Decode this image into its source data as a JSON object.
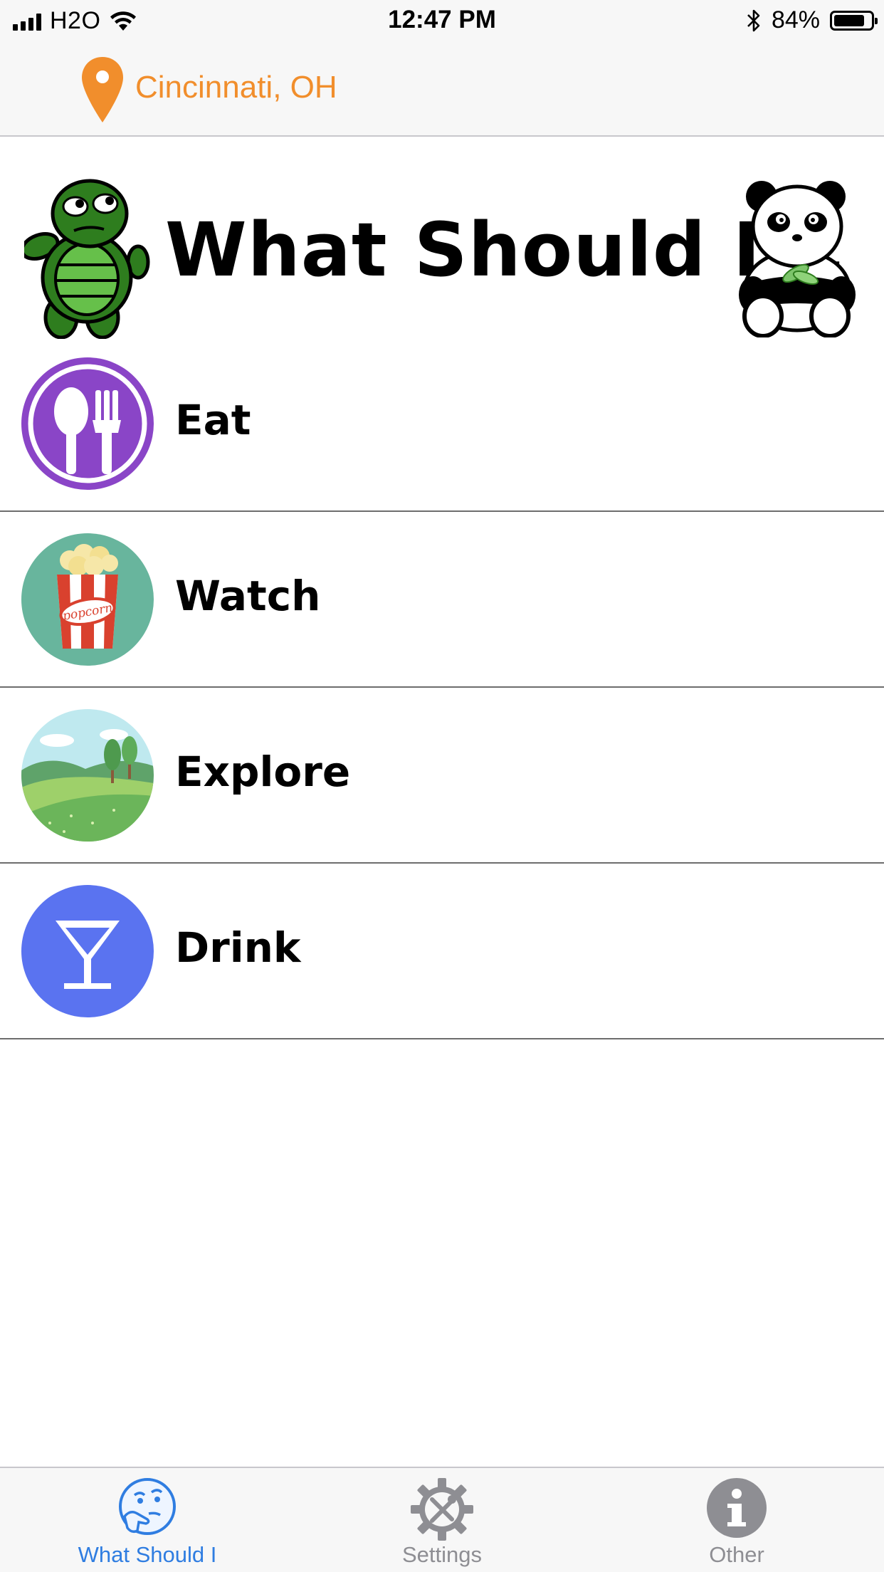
{
  "status_bar": {
    "carrier": "H2O",
    "time": "12:47 PM",
    "battery_percent": "84%",
    "battery_level": 0.84
  },
  "location": {
    "text": "Cincinnati, OH",
    "color": "#f18e2c"
  },
  "title": "What Should I...",
  "categories": [
    {
      "label": "Eat",
      "icon": "fork-spoon-icon",
      "color": "#8a45c7"
    },
    {
      "label": "Watch",
      "icon": "popcorn-icon",
      "color": "#68b59d"
    },
    {
      "label": "Explore",
      "icon": "landscape-icon",
      "color": "#7cc46a"
    },
    {
      "label": "Drink",
      "icon": "cocktail-icon",
      "color": "#5a73f0"
    }
  ],
  "popcorn_text": "popcorn",
  "tabs": [
    {
      "label": "What Should I",
      "icon": "thinking-face-icon",
      "active": true
    },
    {
      "label": "Settings",
      "icon": "gear-tools-icon",
      "active": false
    },
    {
      "label": "Other",
      "icon": "info-icon",
      "active": false
    }
  ],
  "colors": {
    "accent": "#2f7de1",
    "inactive": "#8e8e93"
  }
}
